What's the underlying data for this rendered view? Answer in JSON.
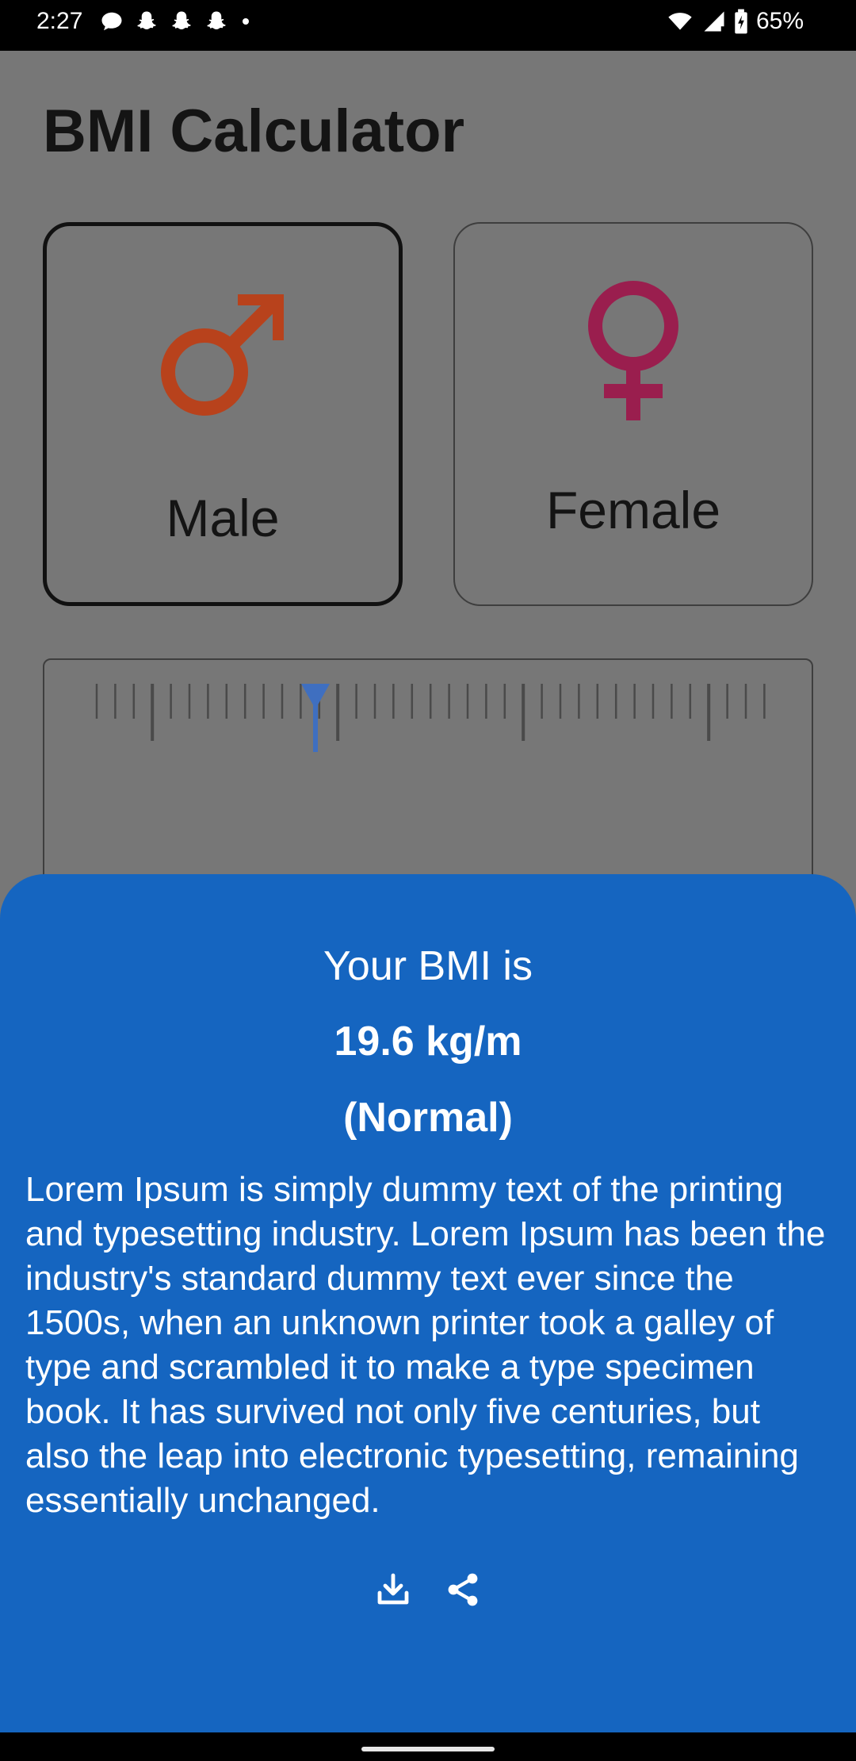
{
  "status_bar": {
    "time": "2:27",
    "battery": "65%",
    "icons": [
      "chat-bubble-icon",
      "snapchat-icon",
      "snapchat-icon",
      "snapchat-icon",
      "dot-icon",
      "wifi-icon",
      "signal-icon",
      "battery-icon"
    ]
  },
  "app": {
    "title": "BMI Calculator",
    "gender": {
      "male_label": "Male",
      "female_label": "Female",
      "selected": "Male",
      "male_color": "#B8421C",
      "female_color": "#9A1E4E"
    },
    "ruler_indicator_color": "#3F6FC0"
  },
  "sheet": {
    "heading": "Your BMI is",
    "value": "19.6 kg/m",
    "category": "(Normal)",
    "description": "Lorem Ipsum is simply dummy text of the printing and typesetting industry. Lorem Ipsum has been the industry's standard dummy text ever since the 1500s, when an unknown printer took a galley of type and scrambled it to make a type specimen book. It has survived not only five centuries, but also the leap into electronic typesetting, remaining essentially unchanged.",
    "actions": [
      "download-icon",
      "share-icon"
    ],
    "background": "#1565C0"
  }
}
